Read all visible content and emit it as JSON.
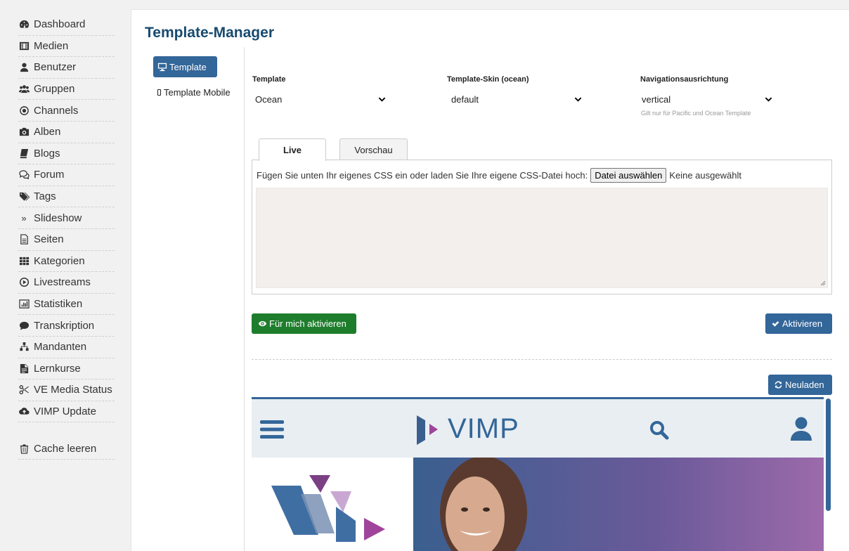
{
  "sidebar": {
    "items": [
      {
        "label": "Dashboard",
        "icon": "dashboard-icon"
      },
      {
        "label": "Medien",
        "icon": "film-icon"
      },
      {
        "label": "Benutzer",
        "icon": "user-icon"
      },
      {
        "label": "Gruppen",
        "icon": "users-icon"
      },
      {
        "label": "Channels",
        "icon": "channel-icon"
      },
      {
        "label": "Alben",
        "icon": "camera-icon"
      },
      {
        "label": "Blogs",
        "icon": "book-icon"
      },
      {
        "label": "Forum",
        "icon": "comments-icon"
      },
      {
        "label": "Tags",
        "icon": "tags-icon"
      },
      {
        "label": "Slideshow",
        "icon": "double-chevron-icon"
      },
      {
        "label": "Seiten",
        "icon": "file-icon"
      },
      {
        "label": "Kategorien",
        "icon": "grid-icon"
      },
      {
        "label": "Livestreams",
        "icon": "play-circle-icon"
      },
      {
        "label": "Statistiken",
        "icon": "chart-icon"
      },
      {
        "label": "Transkription",
        "icon": "speech-bubble-icon"
      },
      {
        "label": "Mandanten",
        "icon": "sitemap-icon"
      },
      {
        "label": "Lernkurse",
        "icon": "document-icon"
      },
      {
        "label": "VE Media Status",
        "icon": "scissors-icon"
      },
      {
        "label": "VIMP Update",
        "icon": "cloud-upload-icon"
      }
    ],
    "cache_label": "Cache leeren"
  },
  "page": {
    "title": "Template-Manager"
  },
  "subnav": {
    "template_label": "Template",
    "mobile_label": "Template Mobile"
  },
  "form": {
    "template_label": "Template",
    "template_value": "Ocean",
    "skin_label": "Template-Skin (ocean)",
    "skin_value": "default",
    "nav_label": "Navigationsausrichtung",
    "nav_value": "vertical",
    "nav_help": "Gilt nur für Pacific und Ocean Template"
  },
  "tabs": {
    "live": "Live",
    "preview": "Vorschau"
  },
  "css": {
    "instruction": "Fügen Sie unten Ihr eigenes CSS ein oder laden Sie Ihre eigene CSS-Datei hoch:",
    "file_button": "Datei auswählen",
    "file_status": "Keine ausgewählt"
  },
  "buttons": {
    "activate_me": "Für mich aktivieren",
    "activate": "Aktivieren",
    "reload": "Neuladen"
  },
  "preview": {
    "logo_text": "VIMP"
  },
  "colors": {
    "accent": "#336699",
    "title": "#184b70",
    "green": "#1e7d2c"
  }
}
